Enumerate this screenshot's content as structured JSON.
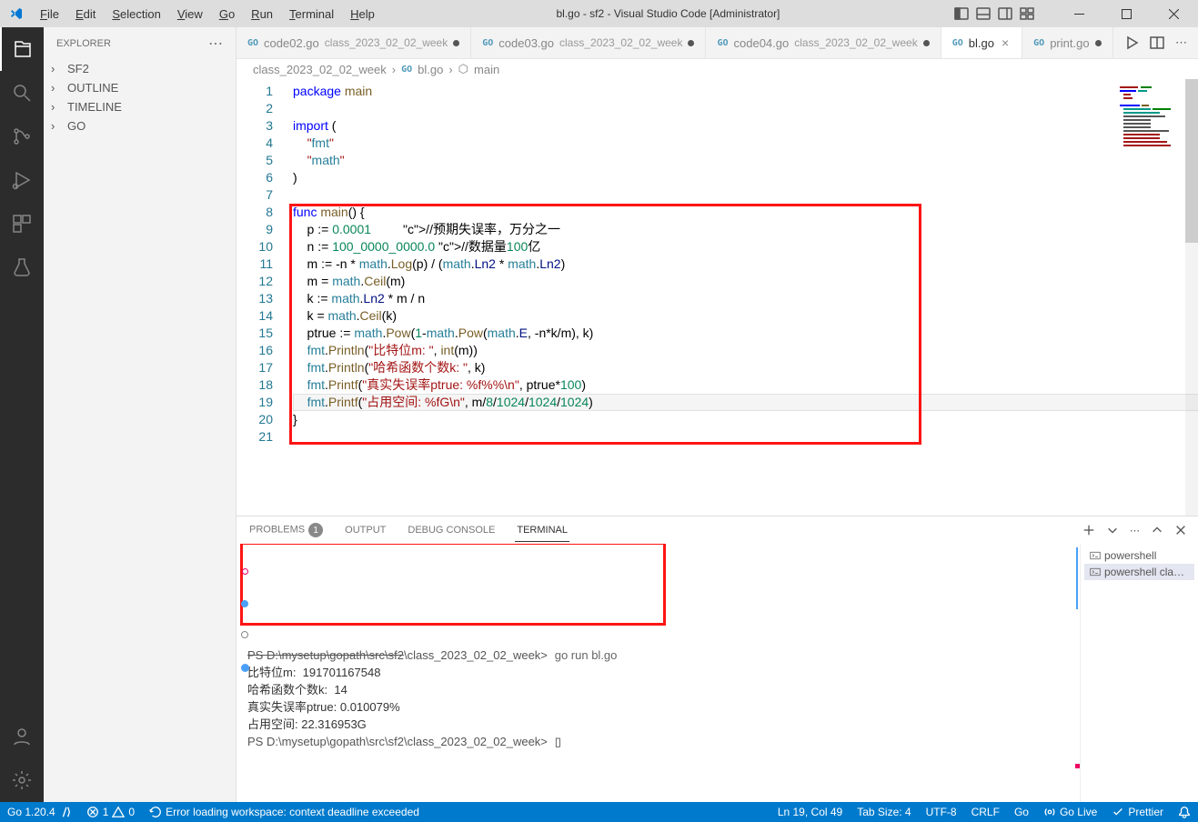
{
  "window_title": "bl.go - sf2 - Visual Studio Code [Administrator]",
  "menu": {
    "file": "File",
    "edit": "Edit",
    "selection": "Selection",
    "view": "View",
    "go": "Go",
    "run": "Run",
    "terminal": "Terminal",
    "help": "Help"
  },
  "sidebar": {
    "title": "EXPLORER",
    "items": [
      {
        "label": "SF2"
      },
      {
        "label": "OUTLINE"
      },
      {
        "label": "TIMELINE"
      },
      {
        "label": "GO"
      }
    ]
  },
  "tabs": [
    {
      "file": "code02.go",
      "path": "class_2023_02_02_week",
      "dirty": true,
      "active": false
    },
    {
      "file": "code03.go",
      "path": "class_2023_02_02_week",
      "dirty": true,
      "active": false
    },
    {
      "file": "code04.go",
      "path": "class_2023_02_02_week",
      "dirty": true,
      "active": false
    },
    {
      "file": "bl.go",
      "path": "",
      "dirty": false,
      "active": true
    },
    {
      "file": "print.go",
      "path": "",
      "dirty": true,
      "active": false
    }
  ],
  "breadcrumb": {
    "folder": "class_2023_02_02_week",
    "file": "bl.go",
    "symbol": "main"
  },
  "code": {
    "lines": 21,
    "src": [
      "package main",
      "",
      "import (",
      "    \"fmt\"",
      "    \"math\"",
      ")",
      "",
      "func main() {",
      "    p := 0.0001         //预期失误率，万分之一",
      "    n := 100_0000_0000.0 //数据量100亿",
      "    m := -n * math.Log(p) / (math.Ln2 * math.Ln2)",
      "    m = math.Ceil(m)",
      "    k := math.Ln2 * m / n",
      "    k = math.Ceil(k)",
      "    ptrue := math.Pow(1-math.Pow(math.E, -n*k/m), k)",
      "    fmt.Println(\"比特位m: \", int(m))",
      "    fmt.Println(\"哈希函数个数k: \", k)",
      "    fmt.Printf(\"真实失误率ptrue: %f%%\\n\", ptrue*100)",
      "    fmt.Printf(\"占用空间: %fG\\n\", m/8/1024/1024/1024)",
      "}",
      ""
    ]
  },
  "panel": {
    "tabs": {
      "problems": "PROBLEMS",
      "problems_count": "1",
      "output": "OUTPUT",
      "debug": "DEBUG CONSOLE",
      "terminal": "TERMINAL"
    },
    "terminal": {
      "prompt1_struck": "PS D:\\mysetup\\gopath\\src\\sf2",
      "prompt1_rest": "\\class_2023_02_02_week>",
      "cmd1": "go run bl.go",
      "out1": "比特位m:  191701167548",
      "out2": "哈希函数个数k:  14",
      "out3": "真实失误率ptrue: 0.010079%",
      "out4": "占用空间: 22.316953G",
      "prompt2": "PS D:\\mysetup\\gopath\\src\\sf2\\class_2023_02_02_week>",
      "cursor": "▯"
    },
    "shells": [
      {
        "label": "powershell"
      },
      {
        "label": "powershell  cla…"
      }
    ]
  },
  "status": {
    "go": "Go 1.20.4",
    "err_warn": "1  0",
    "err_msg": "Error loading workspace: context deadline exceeded",
    "pos": "Ln 19, Col 49",
    "indent": "Tab Size: 4",
    "enc": "UTF-8",
    "eol": "CRLF",
    "lang": "Go",
    "golive": "Go Live",
    "prettier": "Prettier"
  }
}
